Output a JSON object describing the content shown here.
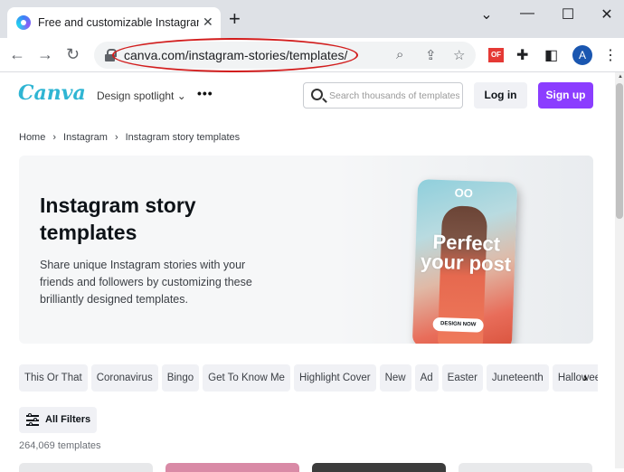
{
  "browser": {
    "tab_title": "Free and customizable Instagram story templates",
    "tab_close": "✕",
    "new_tab": "+",
    "url": "canva.com/instagram-stories/templates/",
    "avatar_letter": "A",
    "ext_badge": "OF",
    "window_controls": {
      "dropdown": "⌄",
      "minimize": "—",
      "maximize": "☐",
      "close": "✕"
    }
  },
  "header": {
    "logo": "Canva",
    "design_spotlight": "Design spotlight ⌄",
    "more": "•••",
    "search_placeholder": "Search thousands of templates",
    "login": "Log in",
    "signup": "Sign up"
  },
  "breadcrumb": [
    "Home",
    "Instagram",
    "Instagram story templates"
  ],
  "hero": {
    "title": "Instagram story templates",
    "description": "Share unique Instagram stories with your friends and followers by customizing these brilliantly designed templates.",
    "phone_logo": "OO",
    "phone_text": "Perfect your post",
    "phone_cta": "DESIGN NOW"
  },
  "chips": [
    "This Or That",
    "Coronavirus",
    "Bingo",
    "Get To Know Me",
    "Highlight Cover",
    "New",
    "Ad",
    "Easter",
    "Juneteenth",
    "Halloween"
  ],
  "filters": {
    "label": "All Filters"
  },
  "results": {
    "count": "264,069 templates"
  },
  "colors": {
    "accent": "#8b3dff",
    "logo": "#2fb5d3",
    "annotation": "#d21d1d"
  }
}
